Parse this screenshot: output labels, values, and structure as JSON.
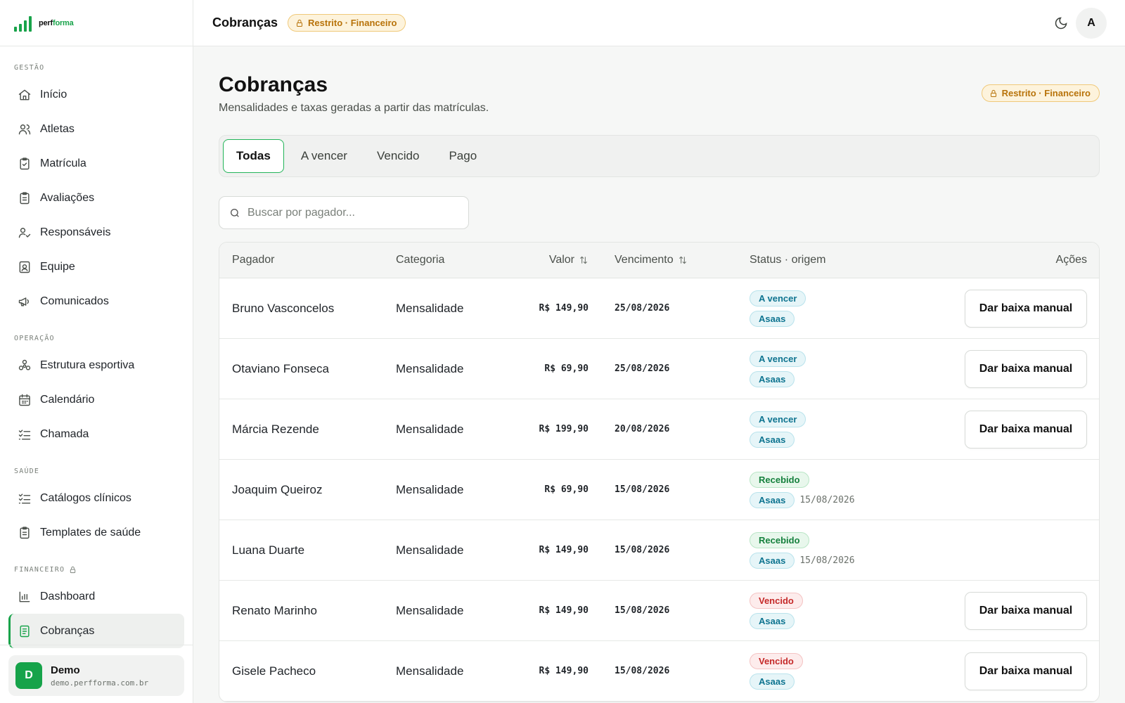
{
  "brand": {
    "name_prefix": "perf",
    "name_suffix": "forma"
  },
  "sidebar": {
    "sections": [
      {
        "label": "GESTÃO",
        "items": [
          {
            "label": "Início",
            "icon": "home-icon"
          },
          {
            "label": "Atletas",
            "icon": "users-icon"
          },
          {
            "label": "Matrícula",
            "icon": "clipboard-check-icon"
          },
          {
            "label": "Avaliações",
            "icon": "clipboard-list-icon"
          },
          {
            "label": "Responsáveis",
            "icon": "user-check-icon"
          },
          {
            "label": "Equipe",
            "icon": "id-badge-icon"
          },
          {
            "label": "Comunicados",
            "icon": "megaphone-icon"
          }
        ]
      },
      {
        "label": "OPERAÇÃO",
        "items": [
          {
            "label": "Estrutura esportiva",
            "icon": "network-icon"
          },
          {
            "label": "Calendário",
            "icon": "calendar-icon"
          },
          {
            "label": "Chamada",
            "icon": "list-checks-icon"
          }
        ]
      },
      {
        "label": "SAÚDE",
        "items": [
          {
            "label": "Catálogos clínicos",
            "icon": "list-checks-icon"
          },
          {
            "label": "Templates de saúde",
            "icon": "clipboard-list-icon"
          }
        ]
      },
      {
        "label": "FINANCEIRO",
        "locked": true,
        "items": [
          {
            "label": "Dashboard",
            "icon": "bar-chart-icon"
          },
          {
            "label": "Cobranças",
            "icon": "file-text-icon",
            "active": true
          }
        ]
      }
    ],
    "user": {
      "initial": "D",
      "name": "Demo",
      "email": "demo.perfforma.com.br"
    }
  },
  "topbar": {
    "title": "Cobranças",
    "badge": "Restrito · Financeiro",
    "avatar": "A"
  },
  "page": {
    "title": "Cobranças",
    "subtitle": "Mensalidades e taxas geradas a partir das matrículas.",
    "badge": "Restrito · Financeiro",
    "tabs": [
      "Todas",
      "A vencer",
      "Vencido",
      "Pago"
    ],
    "active_tab": "Todas",
    "search": {
      "placeholder": "Buscar por pagador..."
    }
  },
  "table": {
    "headers": {
      "payer": "Pagador",
      "category": "Categoria",
      "value": "Valor",
      "due": "Vencimento",
      "status": "Status · origem",
      "actions": "Ações"
    },
    "action_label": "Dar baixa manual",
    "rows": [
      {
        "payer": "Bruno Vasconcelos",
        "category": "Mensalidade",
        "value": "R$ 149,90",
        "due": "25/08/2026",
        "status": "A vencer",
        "status_kind": "avencer",
        "origin": "Asaas",
        "paid_date": "",
        "action": true
      },
      {
        "payer": "Otaviano Fonseca",
        "category": "Mensalidade",
        "value": "R$ 69,90",
        "due": "25/08/2026",
        "status": "A vencer",
        "status_kind": "avencer",
        "origin": "Asaas",
        "paid_date": "",
        "action": true
      },
      {
        "payer": "Márcia Rezende",
        "category": "Mensalidade",
        "value": "R$ 199,90",
        "due": "20/08/2026",
        "status": "A vencer",
        "status_kind": "avencer",
        "origin": "Asaas",
        "paid_date": "",
        "action": true
      },
      {
        "payer": "Joaquim Queiroz",
        "category": "Mensalidade",
        "value": "R$ 69,90",
        "due": "15/08/2026",
        "status": "Recebido",
        "status_kind": "recebido",
        "origin": "Asaas",
        "paid_date": "15/08/2026",
        "action": false
      },
      {
        "payer": "Luana Duarte",
        "category": "Mensalidade",
        "value": "R$ 149,90",
        "due": "15/08/2026",
        "status": "Recebido",
        "status_kind": "recebido",
        "origin": "Asaas",
        "paid_date": "15/08/2026",
        "action": false
      },
      {
        "payer": "Renato Marinho",
        "category": "Mensalidade",
        "value": "R$ 149,90",
        "due": "15/08/2026",
        "status": "Vencido",
        "status_kind": "vencido",
        "origin": "Asaas",
        "paid_date": "",
        "action": true
      },
      {
        "payer": "Gisele Pacheco",
        "category": "Mensalidade",
        "value": "R$ 149,90",
        "due": "15/08/2026",
        "status": "Vencido",
        "status_kind": "vencido",
        "origin": "Asaas",
        "paid_date": "",
        "action": true
      }
    ]
  },
  "colors": {
    "accent": "#18a34a",
    "restricted": "#b8730a",
    "due_soon": "#0e7490",
    "received": "#15803d",
    "overdue": "#c52929"
  }
}
